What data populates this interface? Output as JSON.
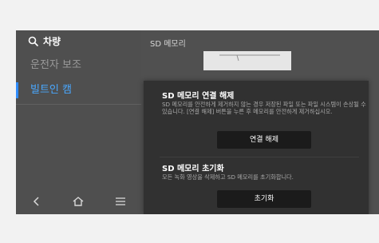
{
  "sidebar": {
    "title": "차량",
    "items": [
      {
        "label": "운전자 보조",
        "active": false
      },
      {
        "label": "빌트인 캠",
        "active": true
      }
    ],
    "nav": [
      {
        "icon": "back-icon"
      },
      {
        "icon": "home-icon"
      },
      {
        "icon": "menu-icon"
      }
    ]
  },
  "content": {
    "title": "SD 메모리"
  },
  "panel": {
    "disconnect": {
      "title": "SD 메모리 연결 해제",
      "description": "SD 메모리를 안전하게 제거하지 않는 경우 저장된 파일 또는 파일 시스템이 손상될 수 있습니다. [연결 해제] 버튼을 누른 후 메모리를 안전하게 제거하십시오.",
      "button": "연결 해제"
    },
    "format": {
      "title": "SD 메모리 초기화",
      "description": "모든 녹화 영상을 삭제하고 SD 메모리를 초기화합니다.",
      "button": "초기화"
    }
  },
  "colors": {
    "accent": "#2f8cff",
    "panel_bg": "#313131",
    "screen_bg": "#505050"
  }
}
